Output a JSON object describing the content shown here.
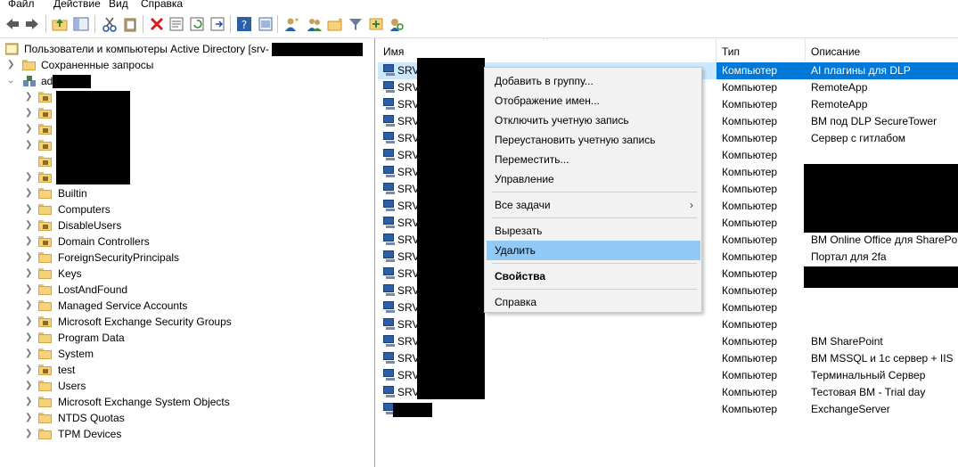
{
  "menu": [
    "Файл",
    "Действие",
    "Вид",
    "Справка"
  ],
  "tree": {
    "root": "Пользователи и компьютеры Active Directory [srv-",
    "saved_queries": "Сохраненные запросы",
    "domain": "ad.",
    "folders": [
      "Builtin",
      "Computers",
      "DisableUsers",
      "Domain Controllers",
      "ForeignSecurityPrincipals",
      "Keys",
      "LostAndFound",
      "Managed Service Accounts",
      "Microsoft Exchange Security Groups",
      "Program Data",
      "System",
      "test",
      "Users",
      "Microsoft Exchange System Objects",
      "NTDS Quotas",
      "TPM Devices"
    ]
  },
  "list": {
    "headers": {
      "name": "Имя",
      "type": "Тип",
      "desc": "Описание"
    },
    "rows": [
      {
        "name": "SRV",
        "type": "Компьютер",
        "desc": "AI плагины для DLP"
      },
      {
        "name": "SRV",
        "type": "Компьютер",
        "desc": "RemoteApp"
      },
      {
        "name": "SRV",
        "type": "Компьютер",
        "desc": "RemoteApp"
      },
      {
        "name": "SRV",
        "type": "Компьютер",
        "desc": "ВМ под DLP SecureTower"
      },
      {
        "name": "SRV",
        "type": "Компьютер",
        "desc": "Сервер с гитлабом"
      },
      {
        "name": "SRV",
        "type": "Компьютер",
        "desc": ""
      },
      {
        "name": "SRV",
        "type": "Компьютер",
        "desc": ""
      },
      {
        "name": "SRV",
        "type": "Компьютер",
        "desc": ""
      },
      {
        "name": "SRV",
        "type": "Компьютер",
        "desc": ""
      },
      {
        "name": "SRV",
        "type": "Компьютер",
        "desc": ""
      },
      {
        "name": "SRV",
        "type": "Компьютер",
        "desc": "ВМ Online Office для SharePoint"
      },
      {
        "name": "SRV",
        "type": "Компьютер",
        "desc": "Портал для 2fa"
      },
      {
        "name": "SRV",
        "type": "Компьютер",
        "desc": ""
      },
      {
        "name": "SRV",
        "type": "Компьютер",
        "desc": ""
      },
      {
        "name": "SRV",
        "type": "Компьютер",
        "desc": ""
      },
      {
        "name": "SRV",
        "type": "Компьютер",
        "desc": ""
      },
      {
        "name": "SRV",
        "type": "Компьютер",
        "desc": "ВМ SharePoint"
      },
      {
        "name": "SRV",
        "type": "Компьютер",
        "desc": "ВМ MSSQL и 1с сервер + IIS"
      },
      {
        "name": "SRV",
        "type": "Компьютер",
        "desc": "Терминальный Сервер"
      },
      {
        "name": "SRV",
        "type": "Компьютер",
        "desc": "Тестовая ВМ - Trial day"
      },
      {
        "name": "",
        "type": "Компьютер",
        "desc": "ExchangeServer"
      }
    ]
  },
  "context_menu": {
    "add_to_group": "Добавить в группу...",
    "name_mappings": "Отображение имен...",
    "disable_account": "Отключить учетную запись",
    "reset_account": "Переустановить учетную запись",
    "move": "Переместить...",
    "manage": "Управление",
    "all_tasks": "Все задачи",
    "cut": "Вырезать",
    "delete": "Удалить",
    "properties": "Свойства",
    "help": "Справка"
  },
  "colors": {
    "selection": "#0078d7",
    "highlight": "#91c9f7",
    "folder": "#f6d27a"
  }
}
